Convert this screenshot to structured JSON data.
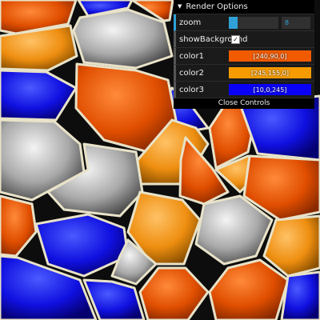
{
  "scene": {
    "palette": [
      "#f05a00",
      "#f59b00",
      "#0a00f5",
      "#c9c9c9"
    ]
  },
  "gui": {
    "folder_title": "Render Options",
    "zoom": {
      "label": "zoom",
      "value": "8",
      "slider_fraction": 0.18
    },
    "showBackground": {
      "label": "showBackground",
      "checked": true
    },
    "colors": [
      {
        "label": "color1",
        "value": "[240,90,0]",
        "hex": "#f05a00"
      },
      {
        "label": "color2",
        "value": "[245,155,0]",
        "hex": "#f59b00"
      },
      {
        "label": "color3",
        "value": "[10,0,245]",
        "hex": "#0a00f5"
      }
    ],
    "close_label": "Close Controls"
  }
}
